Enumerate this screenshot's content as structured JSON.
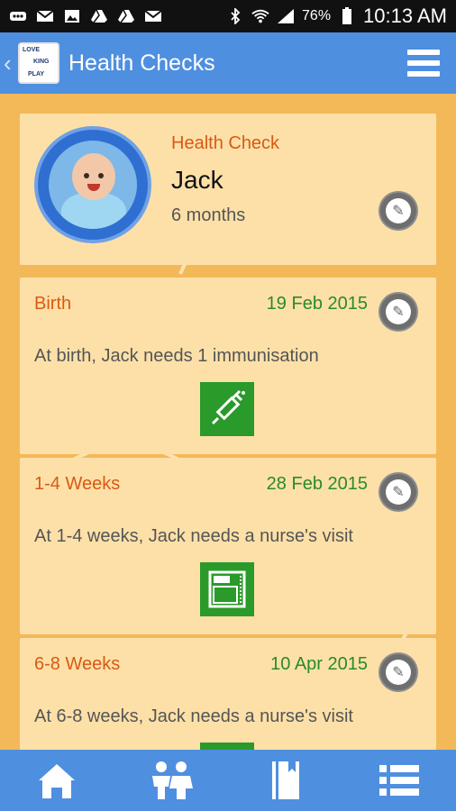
{
  "status_bar": {
    "battery_percent": "76%",
    "time": "10:13 AM",
    "icons": [
      "notification-icon",
      "email-icon",
      "image-icon",
      "drive-icon",
      "drive-icon",
      "email-icon",
      "bluetooth-icon",
      "wifi-icon",
      "signal-icon",
      "battery-icon"
    ]
  },
  "app_bar": {
    "title": "Health Checks",
    "logo_text": [
      "LOVE",
      "KING",
      "PLAY"
    ]
  },
  "profile": {
    "label": "Health Check",
    "name": "Jack",
    "age": "6 months"
  },
  "entries": [
    {
      "title": "Birth",
      "date": "19 Feb 2015",
      "text": "At birth, Jack needs 1 immunisation",
      "icon": "syringe-icon"
    },
    {
      "title": "1-4 Weeks",
      "date": "28 Feb 2015",
      "text": "At 1-4 weeks, Jack needs a nurse's visit",
      "icon": "scale-icon"
    },
    {
      "title": "6-8 Weeks",
      "date": "10 Apr 2015",
      "text": "At 6-8 weeks, Jack needs a nurse's visit",
      "icon": "scale-icon"
    }
  ],
  "colors": {
    "app_bar": "#4f8fe0",
    "background": "#f3b858",
    "card": "#fde0a8",
    "title_orange": "#d85a14",
    "date_green": "#2a8a2a",
    "icon_green": "#2a9a2a"
  },
  "bottom_nav": [
    "home-icon",
    "family-icon",
    "book-icon",
    "list-icon"
  ]
}
